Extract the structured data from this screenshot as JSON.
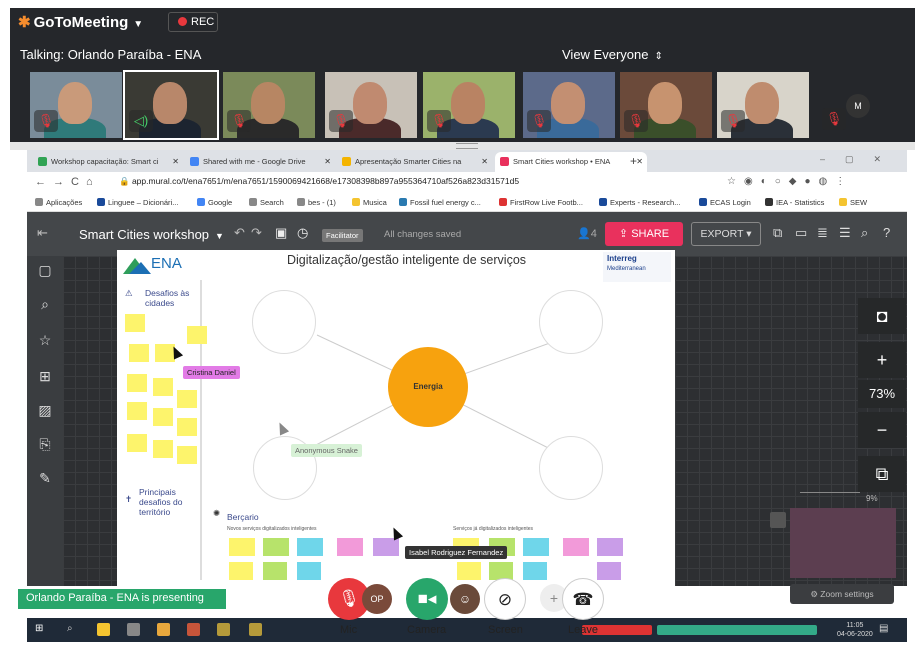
{
  "app": {
    "brand": "GoToMeeting",
    "rec_label": "REC",
    "talking": "Talking: Orlando Paraíba - ENA",
    "view_everyone": "View Everyone",
    "avatar_initial": "M"
  },
  "browser": {
    "tabs": [
      {
        "label": "Workshop capacitação: Smart ci",
        "color": "#31a354"
      },
      {
        "label": "Shared with me - Google Drive",
        "color": "#4285f4"
      },
      {
        "label": "Apresentação Smarter Cities na",
        "color": "#f4b400"
      },
      {
        "label": "Smart Cities workshop • ENA",
        "color": "#e9315d"
      }
    ],
    "url": "app.mural.co/t/ena7651/m/ena7651/1590069421668/e17308398b897a955364710af526a823d31571d5",
    "bookmarks": [
      "Aplicações",
      "Linguee – Dicionári...",
      "Google",
      "Search",
      "bes - (1)",
      "Musica",
      "Fossil fuel energy c...",
      "FirstRow Live Footb...",
      "Experts - Research...",
      "ECAS Login",
      "IEA - Statistics",
      "SEW"
    ]
  },
  "mural": {
    "board_title": "Smart Cities workshop",
    "facilitator": "Facilitator",
    "saved": "All changes saved",
    "user_count": "4",
    "share": "SHARE",
    "export": "EXPORT",
    "heading": "Digitalização/gestão inteligente de serviços",
    "center": "Energia",
    "ena": "ENA",
    "interreg": "Interreg",
    "interreg_sub": "Mediterranean",
    "desafios": "Desafios às cidades",
    "principais": "Principais desafios do território",
    "bercario": "Berçario",
    "novos": "Novos serviços digitalizados inteligentes",
    "servicos": "Serviços já digitalizados inteligentes",
    "cursor_cristina": "Cristina Daniel",
    "cursor_anon": "Anonymous Snake",
    "cursor_isabel": "Isabel Rodriguez Fernandez",
    "zoom": "73%",
    "zoom_settings": "Zoom settings",
    "minimap_pct": "9%"
  },
  "controls": {
    "presenting": "Orlando Paraíba - ENA is presenting",
    "mic": "Mic",
    "camera": "Camera",
    "screen": "Screen",
    "leave": "Leave",
    "avatar_op": "OP"
  },
  "taskbar": {
    "time": "11:05",
    "date": "04-06-2020"
  }
}
